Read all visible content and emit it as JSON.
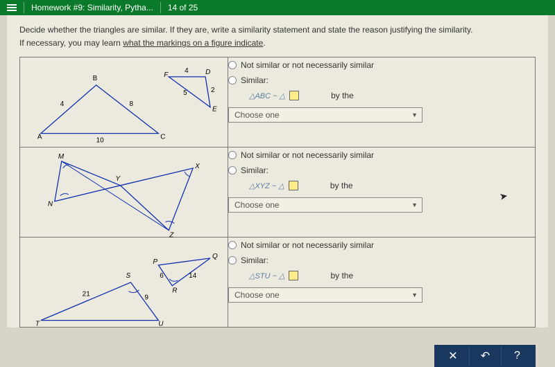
{
  "header": {
    "title": "Homework #9: Similarity, Pytha...",
    "progress": "14 of 25"
  },
  "prompt": {
    "line1": "Decide whether the triangles are similar. If they are, write a similarity statement and state the reason justifying the similarity.",
    "line2_pre": "If necessary, you may learn ",
    "line2_link": "what the markings on a figure indicate",
    "line2_post": "."
  },
  "options": {
    "not_similar": "Not similar or not necessarily similar",
    "similar": "Similar:",
    "by_the": "by the",
    "choose_one": "Choose one"
  },
  "rows": [
    {
      "figure": "ABC_FDE",
      "tri_label": "△ABC ~ △",
      "labels": {
        "A": "A",
        "B": "B",
        "C": "C",
        "F": "F",
        "D": "D",
        "E": "E"
      },
      "sides": {
        "AB": "4",
        "BC": "8",
        "AC": "10",
        "FD": "4",
        "DE": "2",
        "FE": "5"
      }
    },
    {
      "figure": "XYZ_MN",
      "tri_label": "△XYZ ~ △",
      "labels": {
        "M": "M",
        "N": "N",
        "X": "X",
        "Y": "Y",
        "Z": "Z"
      }
    },
    {
      "figure": "STU_PQR",
      "tri_label": "△STU ~ △",
      "labels": {
        "S": "S",
        "T": "T",
        "U": "U",
        "P": "P",
        "Q": "Q",
        "R": "R"
      },
      "sides": {
        "ST": "21",
        "SU": "9",
        "PR": "6",
        "PQ": "14"
      }
    }
  ],
  "footer": {
    "close": "✕",
    "undo": "↶",
    "help": "?"
  }
}
